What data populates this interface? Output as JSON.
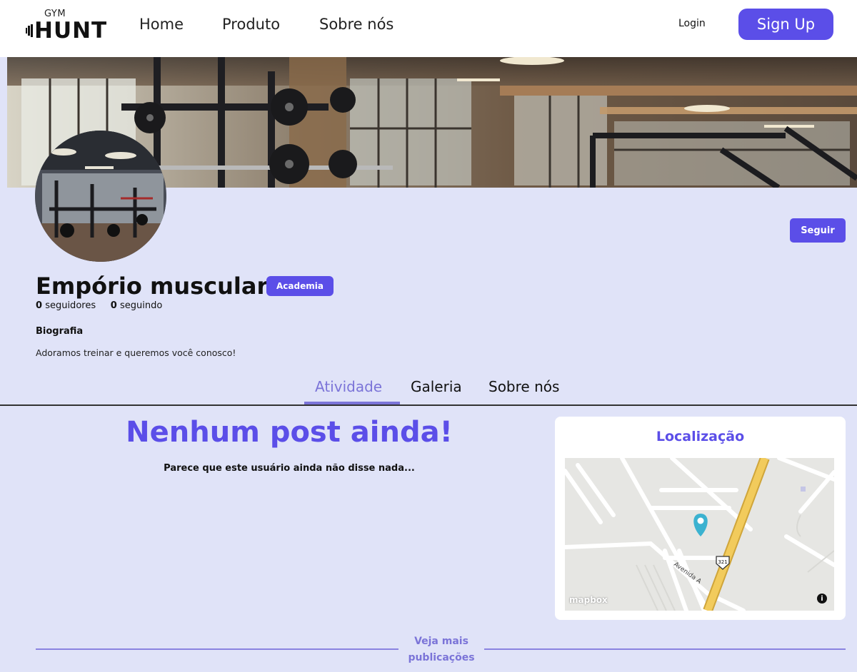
{
  "header": {
    "logo_small": "GYM",
    "logo_big": "HUNT",
    "nav": [
      "Home",
      "Produto",
      "Sobre nós"
    ],
    "login_label": "Login",
    "signup_label": "Sign Up"
  },
  "profile": {
    "name": "Empório muscular",
    "badge": "Academia",
    "followers_count": "0",
    "followers_label": "seguidores",
    "following_count": "0",
    "following_label": "seguindo",
    "bio_title": "Biografia",
    "bio_text": "Adoramos treinar e queremos você conosco!",
    "follow_label": "Seguir"
  },
  "tabs": [
    "Atividade",
    "Galeria",
    "Sobre nós"
  ],
  "feed": {
    "empty_title": "Nenhum post ainda!",
    "empty_subtitle": "Parece que este usuário ainda não disse nada...",
    "more_label_line1": "Veja mais",
    "more_label_line2": "publicações"
  },
  "location": {
    "title": "Localização",
    "map_road_label": "Avenida A",
    "map_route_number": "321",
    "map_attribution": "mapbox",
    "map_info": "i"
  },
  "colors": {
    "accent": "#5b4ee8",
    "accent_light": "#7b74d8",
    "page_background": "#e0e3f8"
  }
}
